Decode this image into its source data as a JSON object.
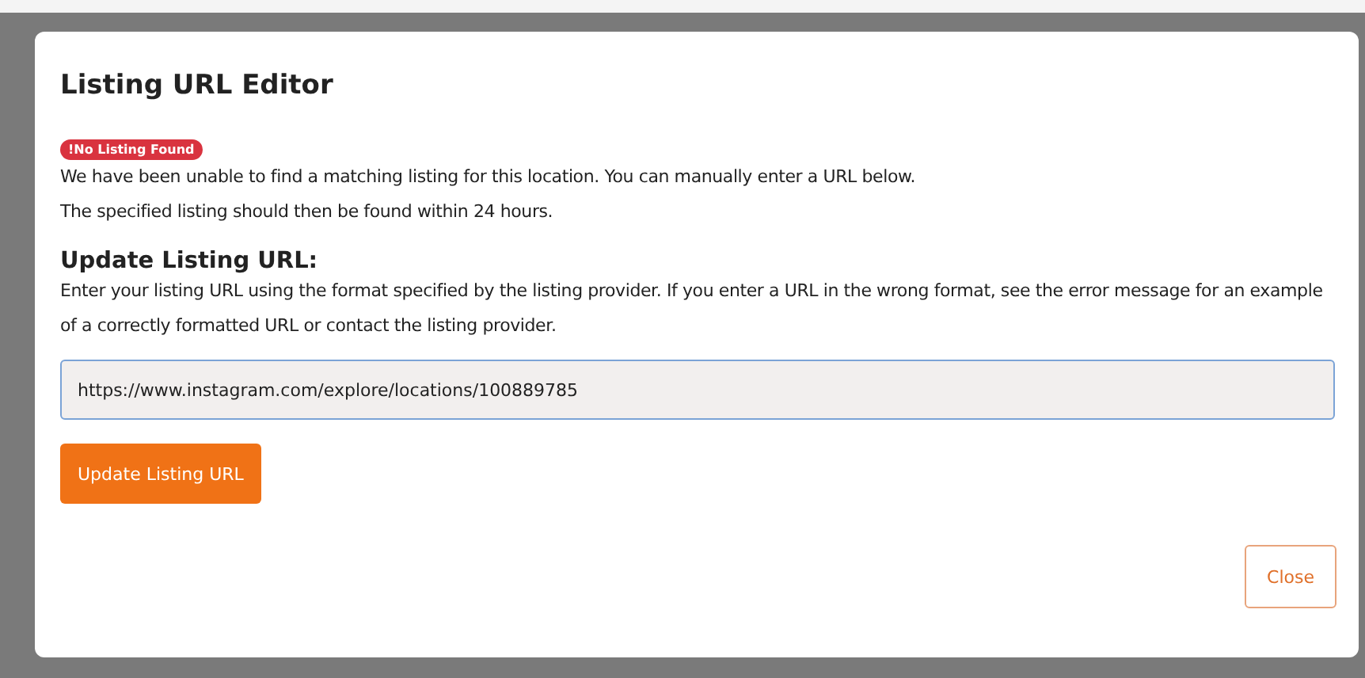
{
  "dialog": {
    "title": "Listing URL Editor",
    "badge": "!No Listing Found",
    "message_lines": [
      "We have been unable to find a matching listing for this location. You can manually enter a URL below.",
      "The specified listing should then be found within 24 hours."
    ],
    "section_heading": "Update Listing URL:",
    "instructions": "Enter your listing URL using the format specified by the listing provider. If you enter a URL in the wrong format, see the error message for an example of a correctly formatted URL or contact the listing provider.",
    "url_field": {
      "value": "https://www.instagram.com/explore/locations/100889785"
    },
    "update_button": "Update Listing URL",
    "close_button": "Close"
  }
}
